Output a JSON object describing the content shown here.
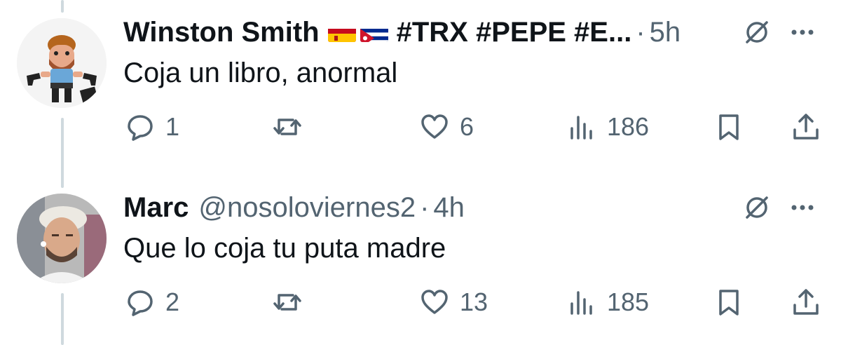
{
  "tweets": [
    {
      "author": "Winston Smith",
      "flags": [
        "spain-flag",
        "cuba-flag"
      ],
      "hashtags": "#TRX #PEPE #E...",
      "handle": "",
      "dot": "·",
      "time": "5h",
      "text": "Coja un libro, anormal",
      "replies": "1",
      "reposts": "",
      "likes": "6",
      "views": "186"
    },
    {
      "author": "Marc",
      "flags": [],
      "hashtags": "",
      "handle": "@nosoloviernes2",
      "dot": "·",
      "time": "4h",
      "text": "Que lo coja tu puta madre",
      "replies": "2",
      "reposts": "",
      "likes": "13",
      "views": "185"
    }
  ],
  "icons": [
    "reply-icon",
    "repost-icon",
    "like-icon",
    "views-icon",
    "bookmark-icon",
    "share-icon",
    "grok-icon",
    "more-icon"
  ],
  "colors": {
    "text": "#0f1419",
    "secondary": "#536471",
    "thread_line": "#cfd9de"
  }
}
